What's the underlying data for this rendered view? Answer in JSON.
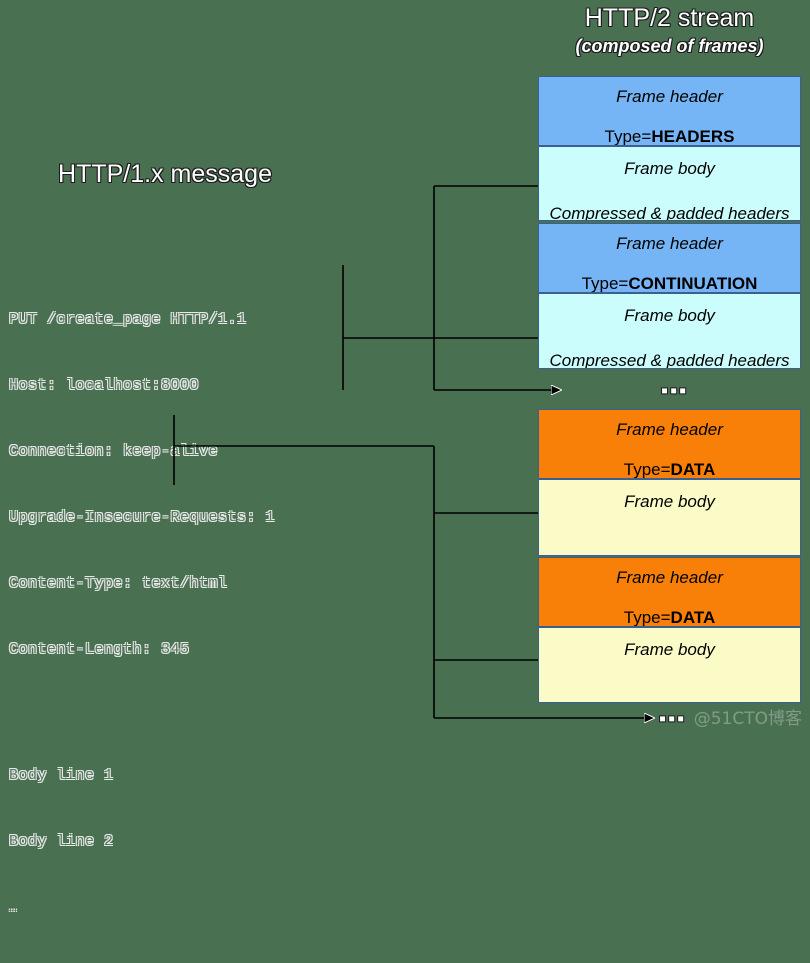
{
  "background_color": "#4a7052",
  "left_panel": {
    "title": "HTTP/1.x message",
    "message_lines": [
      "PUT /create_page HTTP/1.1",
      "Host: localhost:8000",
      "Connection: keep-alive",
      "Upgrade-Insecure-Requests: 1",
      "Content-Type: text/html",
      "Content-Length: 345"
    ],
    "body_lines": [
      "Body line 1",
      "Body line 2"
    ],
    "body_ellipsis": "…"
  },
  "right_panel": {
    "title": "HTTP/2 stream",
    "subtitle": "(composed of frames)",
    "frames": [
      {
        "header_label": "Frame header",
        "type_prefix": "Type=",
        "type_value": "HEADERS",
        "header_color": "#76b5f5",
        "body_label": "Frame body",
        "body_sub": "Compressed & padded headers",
        "body_color": "#ccfdfd"
      },
      {
        "header_label": "Frame header",
        "type_prefix": "Type=",
        "type_value": "CONTINUATION",
        "header_color": "#76b5f5",
        "body_label": "Frame body",
        "body_sub": "Compressed & padded headers",
        "body_color": "#ccfdfd"
      },
      {
        "header_label": "Frame header",
        "type_prefix": "Type=",
        "type_value": "DATA",
        "header_color": "#f98008",
        "body_label": "Frame body",
        "body_sub": "",
        "body_color": "#fbfbc8"
      },
      {
        "header_label": "Frame header",
        "type_prefix": "Type=",
        "type_value": "DATA",
        "header_color": "#f98008",
        "body_label": "Frame body",
        "body_sub": "",
        "body_color": "#fbfbc8"
      }
    ],
    "ellipsis_headers": "▪▪▪",
    "ellipsis_data": "▪▪▪"
  },
  "watermark": "@51CTO博客"
}
